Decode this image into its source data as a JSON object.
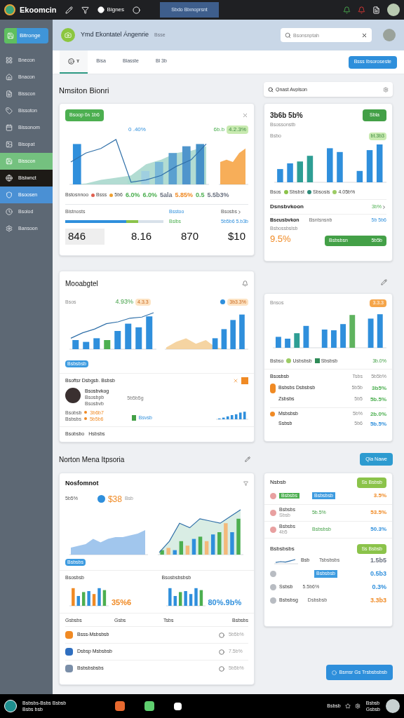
{
  "topbar": {
    "brand": "Ekoomcin",
    "link": "Bignes",
    "tab": "Sbdo Bixnoprsnt"
  },
  "sidebar": {
    "button": "Bitronge",
    "items": [
      {
        "label": "Bnecon",
        "kind": "plain"
      },
      {
        "label": "Bnacon",
        "kind": "plain"
      },
      {
        "label": "Bisscon",
        "kind": "plain"
      },
      {
        "label": "Bissoton",
        "kind": "plain"
      },
      {
        "label": "Bissonom",
        "kind": "plain"
      },
      {
        "label": "Bisopat",
        "kind": "plain"
      },
      {
        "label": "Bisscon",
        "kind": "green"
      },
      {
        "label": "Bisiwnct",
        "kind": "dark"
      },
      {
        "label": "Bsoosen",
        "kind": "blue"
      },
      {
        "label": "Bsoiod",
        "kind": "plain"
      },
      {
        "label": "Bansoon",
        "kind": "plain"
      }
    ]
  },
  "header": {
    "title": "Ymd Ekontatel Ángenrie",
    "subtitle": "Bsse",
    "search_placeholder": "Bsonsnptah"
  },
  "tabs": [
    {
      "label": "ɤ",
      "selected": true
    },
    {
      "label": "Bisa",
      "selected": false
    },
    {
      "label": "Blasste",
      "selected": false
    },
    {
      "label": "Bl 3b",
      "selected": false
    }
  ],
  "action_button": "Bsss Ibsoroseste",
  "section1": {
    "heading": "Nmsiton Bionri",
    "card": {
      "badge": "Bsoop 0ʌ 1b6",
      "annotation": "0 .40%",
      "tag_label": "6b.b",
      "tag": "4.2.3%",
      "legend": [
        {
          "label": "Bstosnnoo"
        },
        {
          "label": "Bsss",
          "color": "#e06050"
        },
        {
          "label": "5b6",
          "color": "#f0a030"
        }
      ],
      "values": [
        {
          "text": "6.0%",
          "color": "#4caf50"
        },
        {
          "text": "6.0%",
          "color": "#4caf50"
        },
        {
          "text": "5ala",
          "color": "#6b7280"
        },
        {
          "text": "5.85%",
          "color": "#f08a24"
        },
        {
          "text": "0.5",
          "color": "#4caf50"
        },
        {
          "text": "5.5b3%",
          "color": "#6b7280"
        }
      ],
      "progress_label": "Bistnosts",
      "mid_label": "Bsstoo",
      "mid_label2": "Bslbs",
      "right_label": "Bsosbs",
      "right_value": "5b5b6 5.b3b",
      "level": 0.62,
      "stats": [
        "846",
        "8.16",
        "870",
        "$10"
      ]
    },
    "search_placeholder": "Qnast Avplson",
    "side_card": {
      "title": "3b6b 5b%",
      "subtitle": "Bsossonstb",
      "button": "Sbla",
      "axis_label": "Bsbo",
      "tag": "bt.3b3",
      "legend": [
        {
          "label": "Sbsbst",
          "color": "#8bc34a"
        },
        {
          "label": "Sbsosis",
          "color": "#2e8b7a"
        },
        {
          "label": "4.05b%",
          "color": "#9ccc65"
        }
      ],
      "legend_title": "Bsos",
      "row_title": "Dsnsbvkoon",
      "row_value": "3b%",
      "detail_title": "Bseusbvkon",
      "detail_label": "Bsntsnsnb",
      "detail_value": "5b 5b6",
      "detail_sub": "Bsbossbslsb",
      "percent": "9.5%",
      "bar_label": "Bsbsbsn",
      "bar_value": "5b5b"
    }
  },
  "section2": {
    "card": {
      "title": "Mooabgtel",
      "axis_label": "Bsos",
      "headline": "4.93%",
      "tag": "4.3.3",
      "tag2": "3b3.3%",
      "chip": "Bsbsbsb",
      "list_title": "Bsoftsr Dsbgsb. Bsbsb",
      "person_name": "Bsosbvkog",
      "person_lines": [
        "Bsosbpb",
        "Bsosbvb"
      ],
      "person_note": "5b5b5g",
      "person_stats": [
        {
          "label": "Bsobsb",
          "value": "3b6b7"
        },
        {
          "label": "Bsbsbs",
          "value": "5b5b6"
        }
      ],
      "legend": "Bsvsb",
      "footer": [
        "Bsobsbo",
        "Hsbsbs"
      ]
    },
    "side_card": {
      "axis_label": "Bnsos",
      "tag": "3.3.3",
      "legend_title": "Bsbso",
      "legend": [
        {
          "label": "Usbsbsb",
          "color": "#9ccc65"
        },
        {
          "label": "Sbsbsb",
          "color": "#2e8b57"
        }
      ],
      "legend_value": "3b.0%",
      "columns": [
        "Bsosbsb",
        "Tsbs",
        "5b5b%"
      ],
      "rows": [
        {
          "name": "Bsbsbs Dsbsbsb",
          "mid": "5b5b",
          "value": "3b5%",
          "color": "#4caf50"
        },
        {
          "name": "Zsbsbs",
          "mid": "5b5",
          "value": "5b.5%",
          "color": "#4caf50"
        },
        {
          "name": "Msbsbsb",
          "mid": "5b%",
          "value": "2b.0%",
          "color": "#4caf50"
        },
        {
          "name": "Ssbsb",
          "mid": "5b6",
          "value": "5b.5%",
          "color": "#2f8fdc"
        }
      ]
    }
  },
  "section3": {
    "heading": "Norton Mena Itpsoria",
    "button": "Qla Nawe",
    "card": {
      "title": "Nosfomnot",
      "axis_label": "5b5%",
      "headline": "$38",
      "headline_sub": "Bsb",
      "chip": "Bsbsbs",
      "mini": [
        {
          "label": "Bsosbsb",
          "value": "35%6",
          "color": "#f08a24"
        },
        {
          "label": "Bsosbsbsbsb",
          "value": "80%.9b%",
          "color": "#2f8fdc"
        }
      ],
      "columns": [
        "Gsbsbs",
        "Gsbs",
        "Tsbs",
        "Bsbsbs"
      ],
      "rows": [
        {
          "name": "Bsss-Msbsbsb",
          "value": "5b5b%",
          "color": "#f08a24"
        },
        {
          "name": "Dsbsp Msbsbsb",
          "value": "7.5b%",
          "color": "#2f6fc0"
        },
        {
          "name": "Bsbsbsbsbs",
          "value": "5b5b%",
          "color": "#7a8ea8"
        }
      ]
    },
    "side_card": {
      "title": "Nsbsb",
      "button": "Ss Bsbsb",
      "rows": [
        {
          "name": "Bsbsbs",
          "chip": "Bsbsbsb",
          "value": "3.5%",
          "color": "#f08a24"
        },
        {
          "name": "Bsbsbs",
          "sub": "Sbsb",
          "mid": "5b.5%",
          "value": "53.5%",
          "color": "#f08a24"
        },
        {
          "name": "Bsbsbs",
          "sub": "4b5",
          "mid": "Bsbsbsb",
          "value": "50.3%",
          "color": "#2f8fdc"
        }
      ],
      "title2": "Bsbsbsbs",
      "button2": "Ss Bsbsb",
      "rows2": [
        {
          "name": "Bsb",
          "mid": "Tsbsbsbs",
          "value": "1.5b5",
          "color": "#6b7280",
          "kind": "chart"
        },
        {
          "mid": "Bsbsbsb",
          "value": "0.5b3",
          "color": "#2f8fdc",
          "kind": "chip"
        },
        {
          "name": "Ssbsb",
          "mid": "5.5b6%",
          "value": "0.3%",
          "color": "#2f8fdc",
          "kind": "text"
        },
        {
          "name": "Bsbsbsg",
          "mid": "Dsbsbsb",
          "value": "3.3b3",
          "color": "#f08a24",
          "kind": "text"
        }
      ]
    },
    "bottom_button": "Bsmsr Gs Trsbsbsbsb"
  },
  "taskbar": {
    "title": "Bsbsbs-Bsbs Bsbsb",
    "subtitle": "Bsbs bsb",
    "tray": "Bsbsb",
    "time": "Bsbsb",
    "date": "Gsbsb"
  }
}
